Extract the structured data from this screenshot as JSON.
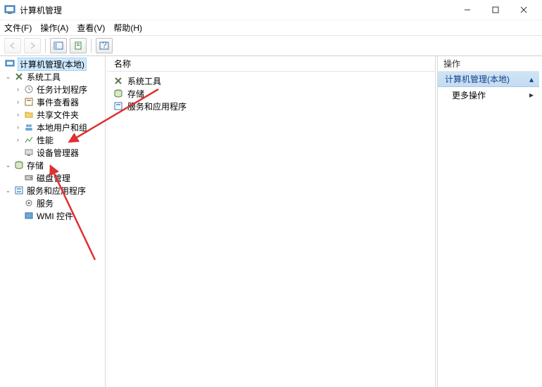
{
  "window": {
    "title": "计算机管理"
  },
  "menu": {
    "file": "文件(F)",
    "action": "操作(A)",
    "view": "查看(V)",
    "help": "帮助(H)"
  },
  "tree": {
    "root": "计算机管理(本地)",
    "system_tools": "系统工具",
    "task_scheduler": "任务计划程序",
    "event_viewer": "事件查看器",
    "shared_folders": "共享文件夹",
    "local_users": "本地用户和组",
    "performance": "性能",
    "device_manager": "设备管理器",
    "storage": "存储",
    "disk_mgmt": "磁盘管理",
    "services_apps": "服务和应用程序",
    "services": "服务",
    "wmi": "WMI 控件"
  },
  "list": {
    "col_name": "名称",
    "item_system_tools": "系统工具",
    "item_storage": "存储",
    "item_services_apps": "服务和应用程序"
  },
  "actions": {
    "header": "操作",
    "title": "计算机管理(本地)",
    "more": "更多操作"
  }
}
